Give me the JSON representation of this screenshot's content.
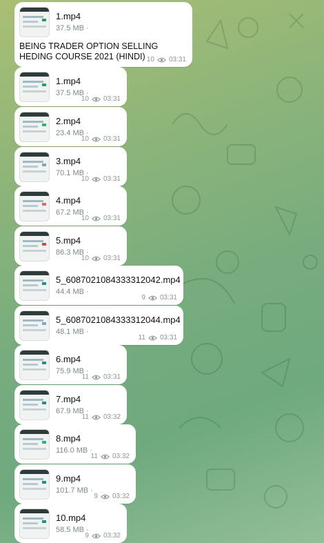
{
  "messages": [
    {
      "name": "1.mp4",
      "size": "37.5 MB",
      "views": "10",
      "time": "03:31",
      "caption": "BEING TRADER OPTION SELLING HEDING COURSE 2021 (HINDI)",
      "accent": "#2e9c5f"
    },
    {
      "name": "1.mp4",
      "size": "37.5 MB",
      "views": "10",
      "time": "03:31",
      "accent": "#2e9c5f"
    },
    {
      "name": "2.mp4",
      "size": "23.4 MB",
      "views": "10",
      "time": "03:31",
      "accent": "#2bb673"
    },
    {
      "name": "3.mp4",
      "size": "70.1 MB",
      "views": "10",
      "time": "03:31",
      "accent": "#7aa8c7"
    },
    {
      "name": "4.mp4",
      "size": "67.2 MB",
      "views": "10",
      "time": "03:31",
      "accent": "#d86b6b"
    },
    {
      "name": "5.mp4",
      "size": "86.3 MB",
      "views": "10",
      "time": "03:31",
      "accent": "#d04a4a"
    },
    {
      "name": "5_6087021084333312042.mp4",
      "size": "44.4 MB",
      "views": "9",
      "time": "03:31",
      "accent": "#1f8f8f"
    },
    {
      "name": "5_6087021084333312044.mp4",
      "size": "48.1 MB",
      "views": "11",
      "time": "03:31",
      "accent": "#7aa8c7"
    },
    {
      "name": "6.mp4",
      "size": "75.9 MB",
      "views": "11",
      "time": "03:31",
      "accent": "#1f8f8f"
    },
    {
      "name": "7.mp4",
      "size": "67.9 MB",
      "views": "11",
      "time": "03:32",
      "accent": "#1f8f8f"
    },
    {
      "name": "8.mp4",
      "size": "116.0 MB",
      "views": "11",
      "time": "03:32",
      "accent": "#2bb673"
    },
    {
      "name": "9.mp4",
      "size": "101.7 MB",
      "views": "9",
      "time": "03:32",
      "accent": "#1f8f8f"
    },
    {
      "name": "10.mp4",
      "size": "58.5 MB",
      "views": "9",
      "time": "03:32",
      "accent": "#1f8f8f"
    }
  ],
  "separator": "·",
  "icons": {
    "views": "eye-icon"
  }
}
